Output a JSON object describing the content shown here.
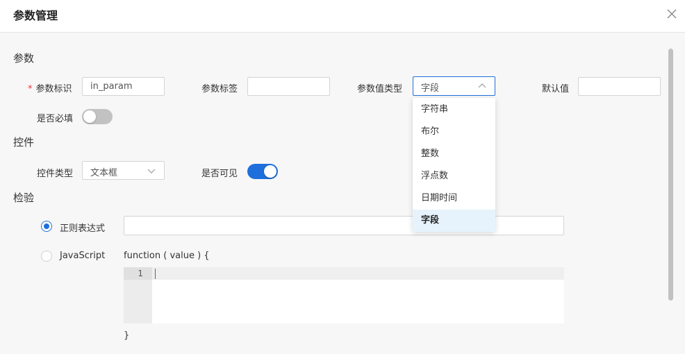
{
  "dialog": {
    "title": "参数管理"
  },
  "sections": {
    "params": "参数",
    "control": "控件",
    "validation": "检验"
  },
  "params": {
    "id_required_mark": "*",
    "id_label": "参数标识",
    "id_value": "in_param",
    "tag_label": "参数标签",
    "tag_value": "",
    "type_label": "参数值类型",
    "type_value": "字段",
    "default_label": "默认值",
    "default_value": "",
    "required_label": "是否必填",
    "required_on": false
  },
  "type_options": [
    "字符串",
    "布尔",
    "整数",
    "浮点数",
    "日期时间",
    "字段"
  ],
  "type_selected_index": 5,
  "control": {
    "type_label": "控件类型",
    "type_value": "文本框",
    "visible_label": "是否可见",
    "visible_on": true
  },
  "validation": {
    "regex_label": "正则表达式",
    "regex_value": "",
    "regex_checked": true,
    "js_label": "JavaScript",
    "js_checked": false,
    "js_header": "function ( value ) {",
    "js_footer": "}",
    "line_number": "1"
  },
  "colors": {
    "accent": "#1e6fdc",
    "required": "#e4393c",
    "selected_option_bg": "#e6f3fc"
  },
  "icons": {
    "close": "close-icon",
    "select_up": "chevron-up-icon",
    "select_down": "chevron-down-icon"
  }
}
